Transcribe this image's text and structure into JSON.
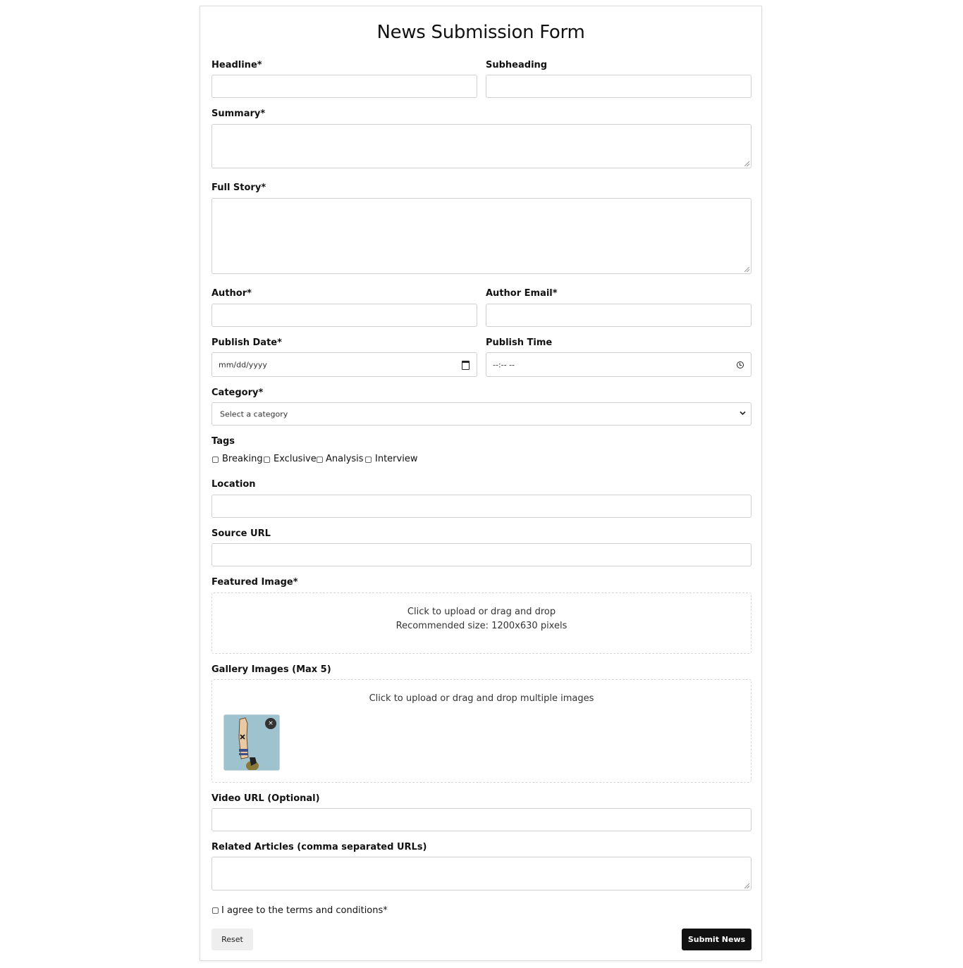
{
  "form": {
    "title": "News Submission Form",
    "headline_label": "Headline*",
    "subheading_label": "Subheading",
    "summary_label": "Summary*",
    "full_story_label": "Full Story*",
    "author_label": "Author*",
    "author_email_label": "Author Email*",
    "publish_date_label": "Publish Date*",
    "publish_date_placeholder": "mm/dd/yyyy",
    "publish_time_label": "Publish Time",
    "publish_time_placeholder": "--:-- --",
    "category_label": "Category*",
    "category_selected": "Select a category",
    "tags_label": "Tags",
    "tags": [
      "Breaking",
      "Exclusive",
      "Analysis",
      "Interview"
    ],
    "location_label": "Location",
    "source_url_label": "Source URL",
    "featured_image_label": "Featured Image*",
    "featured_image_hint_1": "Click to upload or drag and drop",
    "featured_image_hint_2": "Recommended size: 1200x630 pixels",
    "gallery_label": "Gallery Images (Max 5)",
    "gallery_hint": "Click to upload or drag and drop multiple images",
    "gallery_remove_symbol": "×",
    "video_url_label": "Video URL (Optional)",
    "related_articles_label": "Related Articles (comma separated URLs)",
    "terms_label": "I agree to the terms and conditions*",
    "reset_label": "Reset",
    "submit_label": "Submit News"
  }
}
